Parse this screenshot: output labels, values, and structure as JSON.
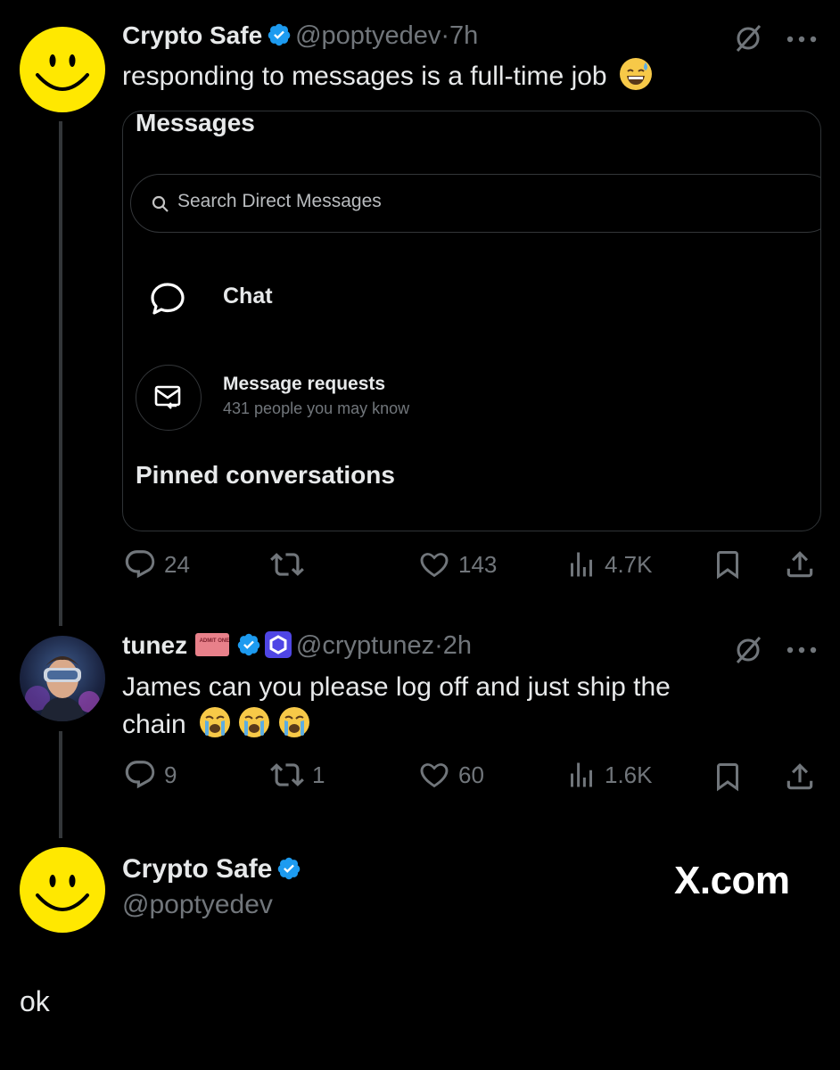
{
  "tweet1": {
    "name": "Crypto Safe",
    "handle": "@poptyedev",
    "time": "7h",
    "text": "responding to messages is a full-time job",
    "card": {
      "title": "Messages",
      "search_placeholder": "Search Direct Messages",
      "chat_label": "Chat",
      "requests_title": "Message requests",
      "requests_sub": "431 people you may know",
      "pinned_heading": "Pinned conversations"
    },
    "stats": {
      "replies": "24",
      "reposts": "",
      "likes": "143",
      "views": "4.7K"
    }
  },
  "tweet2": {
    "name": "tunez",
    "handle": "@cryptunez",
    "time": "2h",
    "text_line1": "James can you please log off and just ship the",
    "text_line2": "chain",
    "badge_text": "ADMIT ONE",
    "stats": {
      "replies": "9",
      "reposts": "1",
      "likes": "60",
      "views": "1.6K"
    }
  },
  "footer_card": {
    "name": "Crypto Safe",
    "handle": "@poptyedev",
    "brand": "X.com"
  },
  "reply_text": "ok",
  "colors": {
    "accent": "#1d9bf0",
    "yellow": "#ffe800",
    "muted": "#71767b"
  },
  "icons": [
    "verified-icon",
    "grok-icon",
    "more-icon",
    "reply-icon",
    "repost-icon",
    "like-icon",
    "views-icon",
    "bookmark-icon",
    "share-icon",
    "chat-bubble-icon",
    "message-request-icon",
    "search-icon"
  ]
}
